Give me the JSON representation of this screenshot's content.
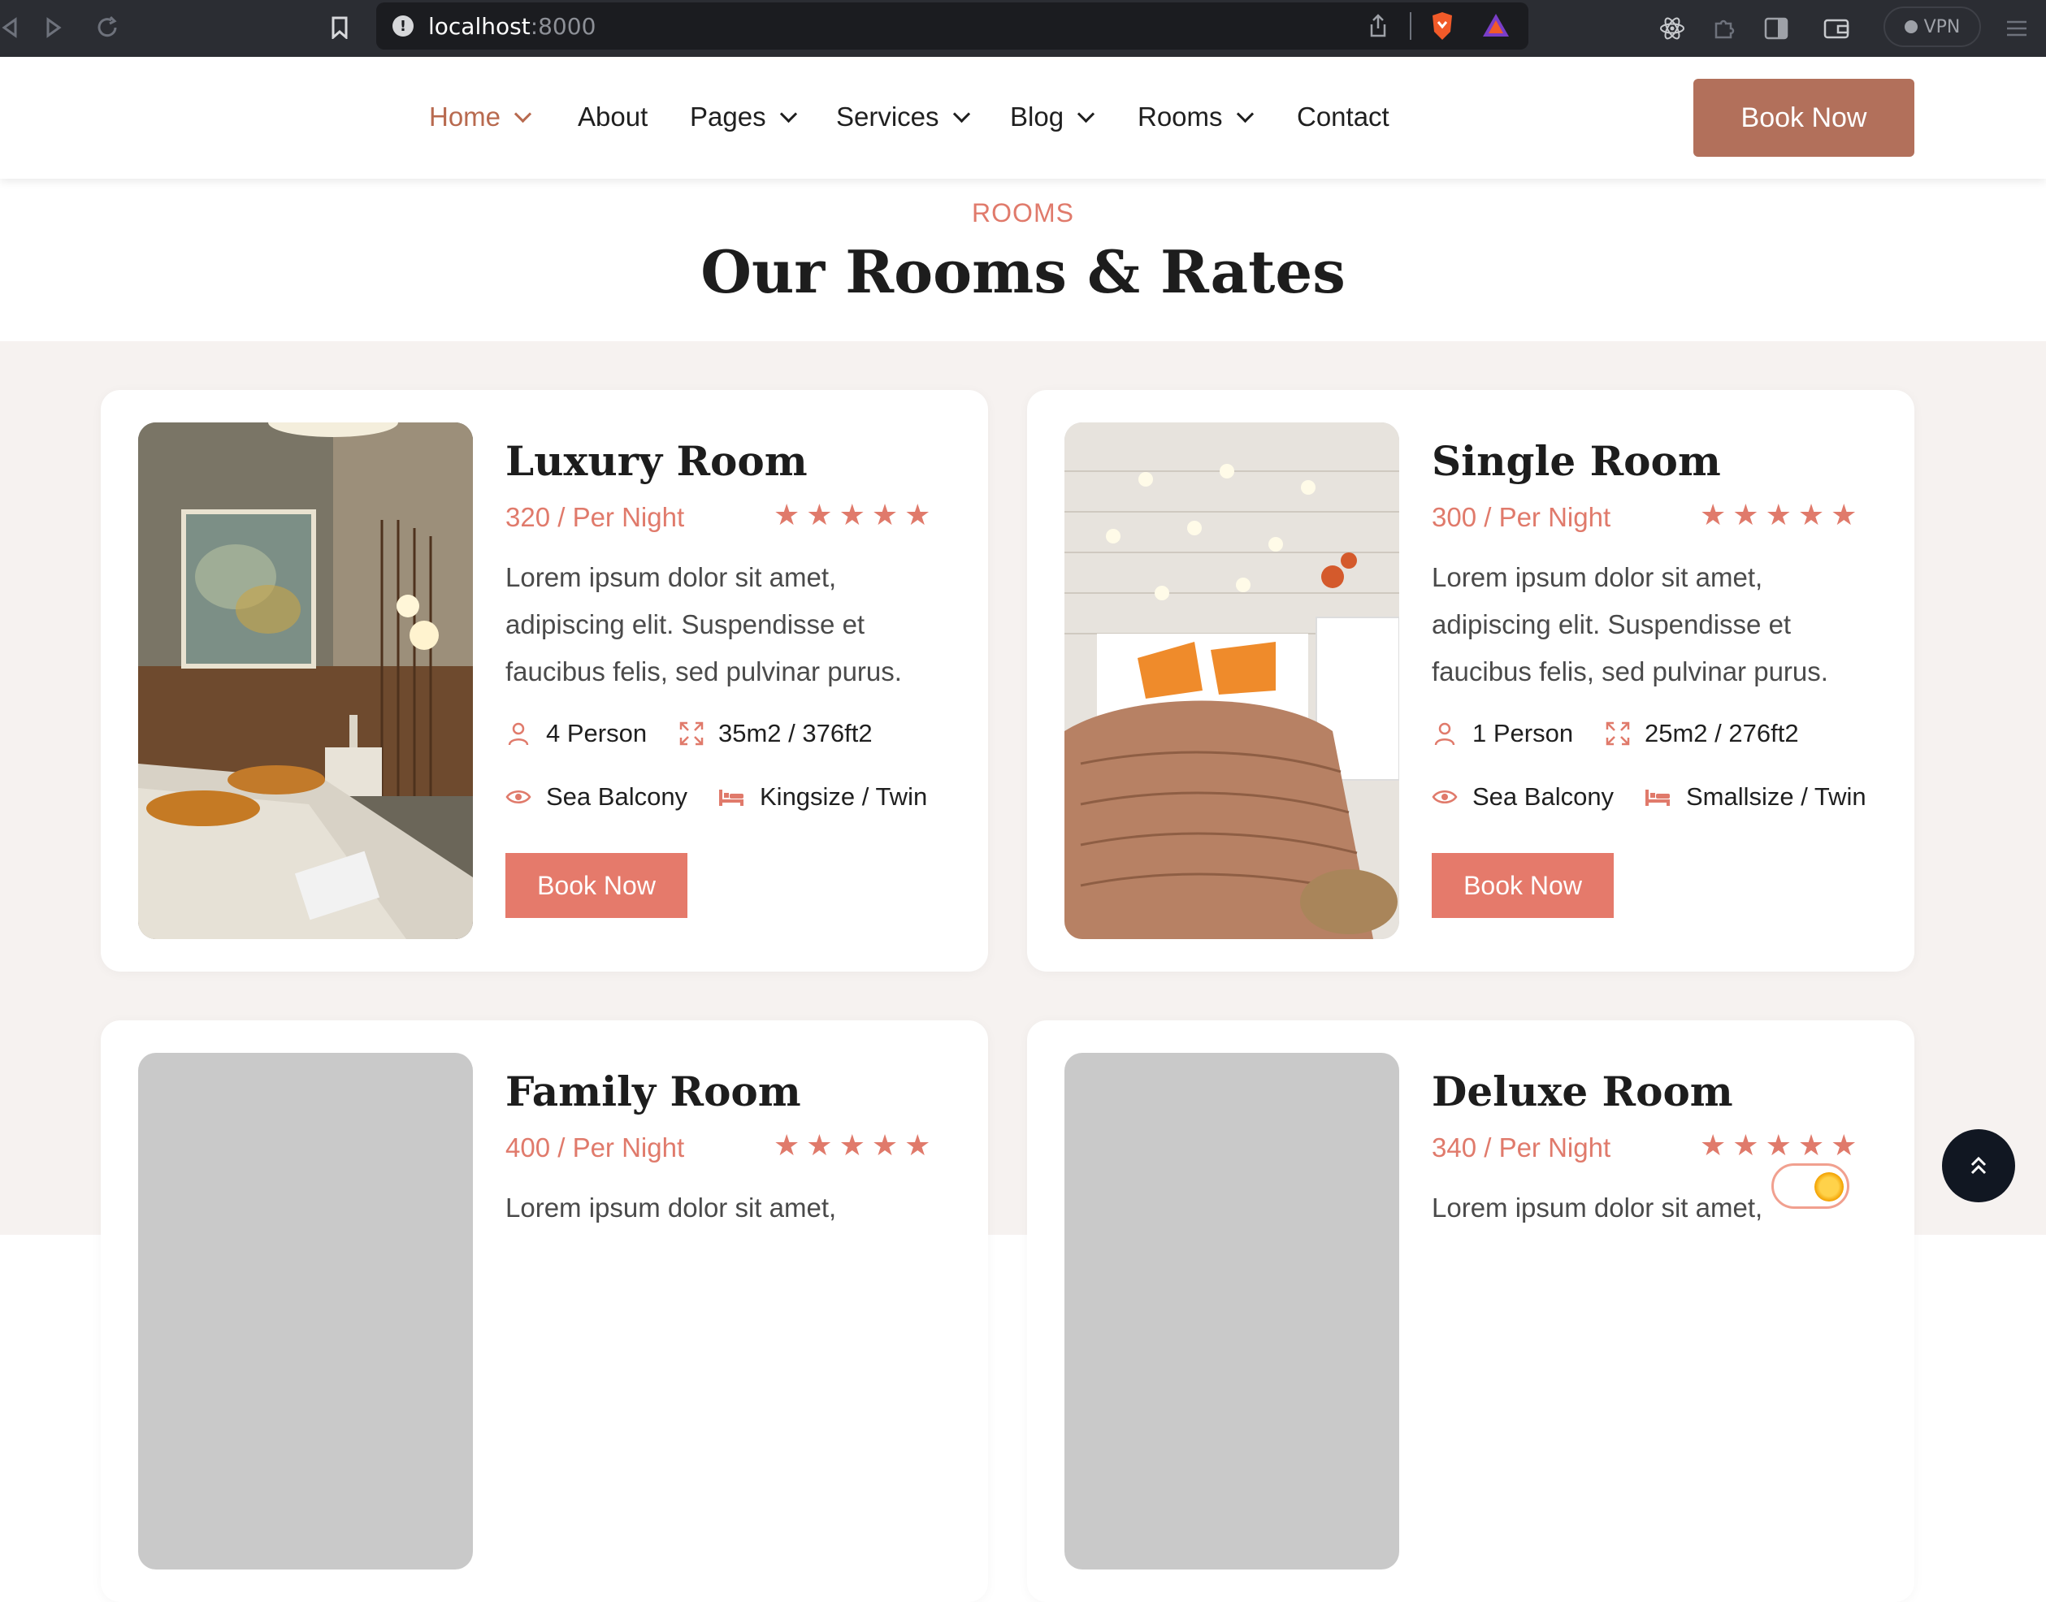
{
  "browser": {
    "address_host": "localhost",
    "address_port": ":8000",
    "vpn_label": "VPN"
  },
  "nav": {
    "items": [
      {
        "label": "Home",
        "dropdown": true,
        "active": true
      },
      {
        "label": "About",
        "dropdown": false,
        "active": false
      },
      {
        "label": "Pages",
        "dropdown": true,
        "active": false
      },
      {
        "label": "Services",
        "dropdown": true,
        "active": false
      },
      {
        "label": "Blog",
        "dropdown": true,
        "active": false
      },
      {
        "label": "Rooms",
        "dropdown": true,
        "active": false
      },
      {
        "label": "Contact",
        "dropdown": false,
        "active": false
      }
    ],
    "book_label": "Book Now"
  },
  "section": {
    "subtitle": "ROOMS",
    "title": "Our Rooms & Rates"
  },
  "rooms": [
    {
      "name": "Luxury Room",
      "price": "320 / Per Night",
      "rating": 5,
      "description": "Lorem ipsum dolor sit amet, adipiscing elit. Suspendisse et faucibus felis, sed pulvinar purus.",
      "persons": "4 Person",
      "size": "35m2 / 376ft2",
      "view": "Sea Balcony",
      "bed": "Kingsize / Twin",
      "button": "Book Now"
    },
    {
      "name": "Single Room",
      "price": "300 / Per Night",
      "rating": 5,
      "description": "Lorem ipsum dolor sit amet, adipiscing elit. Suspendisse et faucibus felis, sed pulvinar purus.",
      "persons": "1 Person",
      "size": "25m2 / 276ft2",
      "view": "Sea Balcony",
      "bed": "Smallsize / Twin",
      "button": "Book Now"
    },
    {
      "name": "Family Room",
      "price": "400 / Per Night",
      "rating": 5,
      "description": "Lorem ipsum dolor sit amet,"
    },
    {
      "name": "Deluxe Room",
      "price": "340 / Per Night",
      "rating": 5,
      "description": "Lorem ipsum dolor sit amet,"
    }
  ],
  "colors": {
    "accent": "#e07a6b",
    "header_button": "#b2705b",
    "active_nav": "#b86a4f"
  }
}
